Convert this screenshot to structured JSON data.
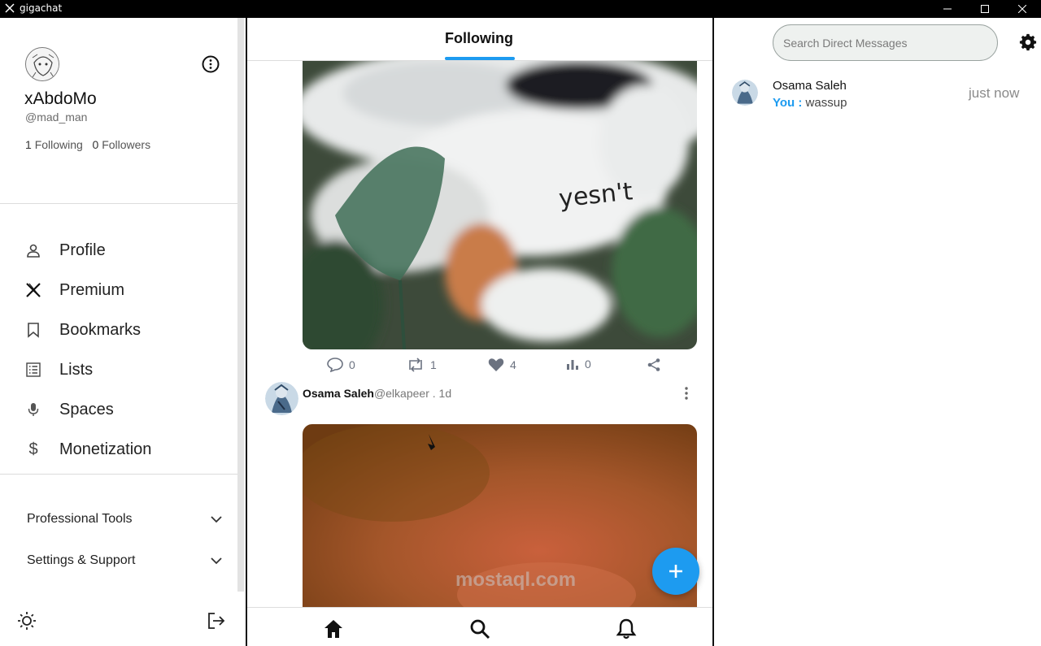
{
  "window": {
    "title": "gigachat"
  },
  "profile": {
    "display_name": "xAbdoMo",
    "handle": "@mad_man",
    "following_count": "1",
    "following_label": "Following",
    "followers_count": "0",
    "followers_label": "Followers"
  },
  "nav": {
    "profile": "Profile",
    "premium": "Premium",
    "bookmarks": "Bookmarks",
    "lists": "Lists",
    "spaces": "Spaces",
    "monetization": "Monetization"
  },
  "accordion": {
    "professional_tools": "Professional Tools",
    "settings_support": "Settings & Support"
  },
  "feed": {
    "active_tab": "Following",
    "post1": {
      "image_caption": "yesn't",
      "replies": "0",
      "reposts": "1",
      "likes": "4",
      "views": "0"
    },
    "post2": {
      "author": "Osama Saleh",
      "handle": "@elkapeer",
      "time": " . 1d"
    }
  },
  "messages": {
    "search_placeholder": "Search Direct Messages",
    "conversations": [
      {
        "name": "Osama Saleh",
        "sender": "You :",
        "text": " wassup",
        "time": "just now"
      }
    ]
  },
  "watermark": "mostaql.com",
  "colors": {
    "accent": "#1d9bf0",
    "titlebar": "#000000"
  }
}
